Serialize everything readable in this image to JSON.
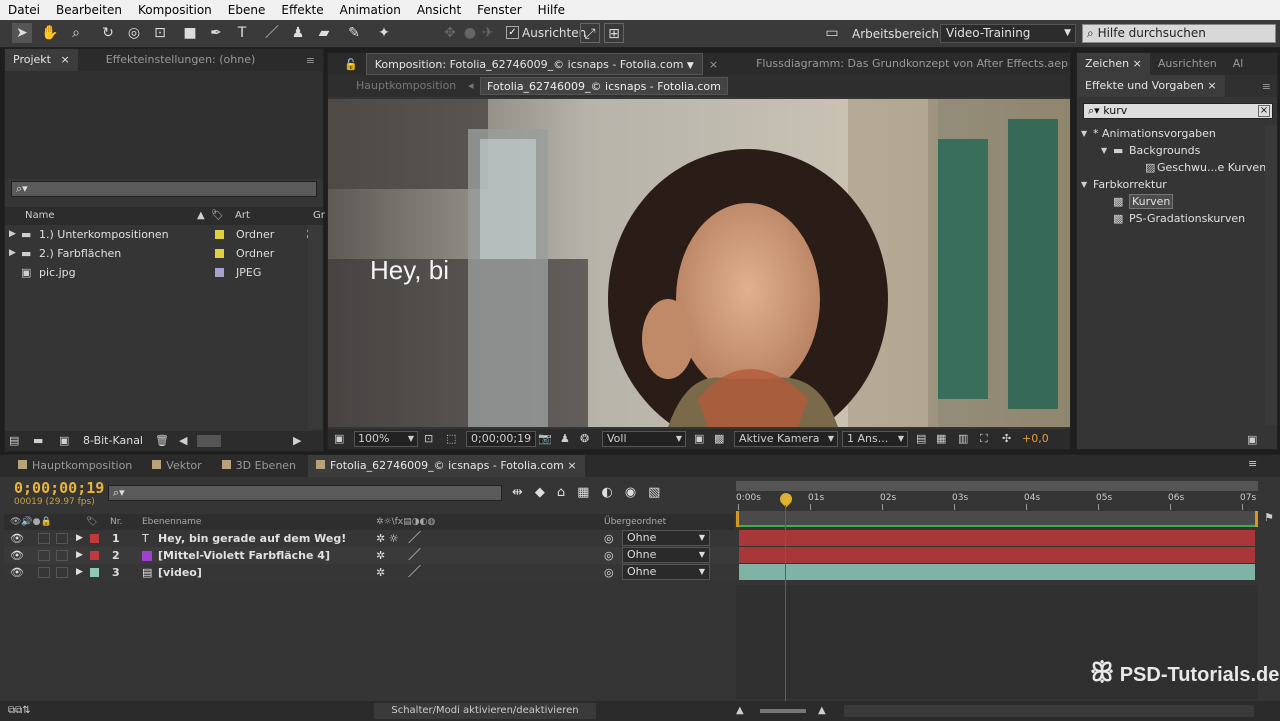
{
  "menu": [
    "Datei",
    "Bearbeiten",
    "Komposition",
    "Ebene",
    "Effekte",
    "Animation",
    "Ansicht",
    "Fenster",
    "Hilfe"
  ],
  "toolbar": {
    "align_label": "Ausrichten",
    "workspace_label": "Arbeitsbereich:",
    "workspace_value": "Video-Training",
    "help_placeholder": "Hilfe durchsuchen"
  },
  "project": {
    "tabs": [
      "Projekt",
      "Effekteinstellungen: (ohne)"
    ],
    "columns": {
      "name": "Name",
      "type": "Art",
      "extra": "Gr"
    },
    "items": [
      {
        "name": "1.) Unterkompositionen",
        "type": "Ordner",
        "color": "#e0d040"
      },
      {
        "name": "2.) Farbflächen",
        "type": "Ordner",
        "color": "#e0d040"
      },
      {
        "name": "pic.jpg",
        "type": "JPEG",
        "color": "#a8a0d0"
      }
    ],
    "bit_depth": "8-Bit-Kanal"
  },
  "comp": {
    "tab": "Komposition: Fotolia_62746009_© icsnaps - Fotolia.com",
    "tab2": "Flussdiagramm: Das Grundkonzept von After Effects.aep",
    "crumb_parent": "Hauptkomposition",
    "crumb_current": "Fotolia_62746009_© icsnaps - Fotolia.com",
    "overlay_text": "Hey, bi",
    "zoom": "100%",
    "timecode": "0;00;00;19",
    "resolution": "Voll",
    "camera": "Aktive Kamera",
    "views": "1 Ans...",
    "exposure": "+0,0"
  },
  "effects": {
    "tabs": [
      "Zeichen",
      "Ausrichten",
      "Al"
    ],
    "panel_title": "Effekte und Vorgaben",
    "search_value": "kurv",
    "tree": [
      {
        "label": "* Animationsvorgaben",
        "level": 0,
        "kind": "group"
      },
      {
        "label": "Backgrounds",
        "level": 1,
        "kind": "folder"
      },
      {
        "label": "Geschwu...e Kurven",
        "level": 2,
        "kind": "preset"
      },
      {
        "label": "Farbkorrektur",
        "level": 0,
        "kind": "group"
      },
      {
        "label": "Kurven",
        "level": 1,
        "kind": "effect",
        "selected": true
      },
      {
        "label": "PS-Gradationskurven",
        "level": 1,
        "kind": "effect"
      }
    ]
  },
  "timeline": {
    "tabs": [
      "Hauptkomposition",
      "Vektor",
      "3D Ebenen",
      "Fotolia_62746009_© icsnaps - Fotolia.com"
    ],
    "timecode": "0;00;00;19",
    "frame_info": "00019 (29.97 fps)",
    "col_nr": "Nr.",
    "col_name": "Ebenenname",
    "col_parent": "Übergeordnet",
    "ruler": [
      "0:00s",
      "01s",
      "02s",
      "03s",
      "04s",
      "05s",
      "06s",
      "07s"
    ],
    "layers": [
      {
        "nr": "1",
        "name": "Hey, bin gerade auf dem Weg!",
        "color": "#c0393b",
        "parent": "Ohne",
        "bar": "#a8373a"
      },
      {
        "nr": "2",
        "name": "[Mittel-Violett Farbfläche 4]",
        "color": "#c0393b",
        "parent": "Ohne",
        "bar": "#a8373a"
      },
      {
        "nr": "3",
        "name": "[video]",
        "color": "#8ec9b8",
        "parent": "Ohne",
        "bar": "#7fb3a5"
      }
    ],
    "footer": "Schalter/Modi aktivieren/deaktivieren"
  },
  "watermark": "PSD-Tutorials.de"
}
